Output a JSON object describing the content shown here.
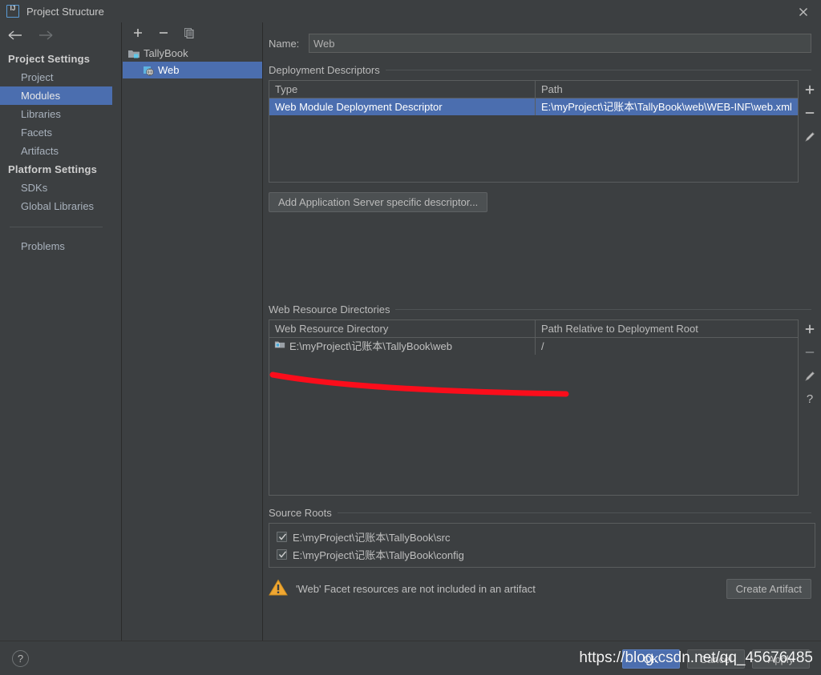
{
  "window": {
    "title": "Project Structure",
    "app_icon": "intellij-idea-icon",
    "close_icon": "close-icon"
  },
  "sidebar": {
    "back_icon": "arrow-left-icon",
    "forward_icon": "arrow-right-icon",
    "groups": [
      {
        "label": "Project Settings",
        "items": [
          {
            "label": "Project",
            "selected": false
          },
          {
            "label": "Modules",
            "selected": true
          },
          {
            "label": "Libraries",
            "selected": false
          },
          {
            "label": "Facets",
            "selected": false
          },
          {
            "label": "Artifacts",
            "selected": false
          }
        ]
      },
      {
        "label": "Platform Settings",
        "items": [
          {
            "label": "SDKs",
            "selected": false
          },
          {
            "label": "Global Libraries",
            "selected": false
          }
        ]
      }
    ],
    "problems_label": "Problems"
  },
  "module_panel": {
    "toolbar": {
      "add_icon": "plus-icon",
      "remove_icon": "minus-icon",
      "copy_icon": "copy-icon"
    },
    "tree": [
      {
        "label": "TallyBook",
        "level": 0,
        "icon": "module-folder-icon",
        "selected": false
      },
      {
        "label": "Web",
        "level": 1,
        "icon": "web-facet-icon",
        "selected": true
      }
    ]
  },
  "main": {
    "name": {
      "label": "Name:",
      "value": "Web"
    },
    "deployment_descriptors": {
      "title": "Deployment Descriptors",
      "columns": [
        "Type",
        "Path"
      ],
      "rows": [
        {
          "type": "Web Module Deployment Descriptor",
          "path": "E:\\myProject\\记账本\\TallyBook\\web\\WEB-INF\\web.xml",
          "selected": true
        }
      ],
      "tools": [
        "plus-icon",
        "minus-icon",
        "pencil-icon"
      ],
      "add_server_descriptor_button": "Add Application Server specific descriptor..."
    },
    "web_resource_directories": {
      "title": "Web Resource Directories",
      "columns": [
        "Web Resource Directory",
        "Path Relative to Deployment Root"
      ],
      "rows": [
        {
          "directory": "E:\\myProject\\记账本\\TallyBook\\web",
          "relative_path": "/",
          "icon": "folder-web-icon"
        }
      ],
      "tools": [
        "plus-icon",
        "minus-icon",
        "pencil-icon",
        "question-icon"
      ]
    },
    "source_roots": {
      "title": "Source Roots",
      "items": [
        {
          "path": "E:\\myProject\\记账本\\TallyBook\\src",
          "checked": true
        },
        {
          "path": "E:\\myProject\\记账本\\TallyBook\\config",
          "checked": true
        }
      ]
    },
    "warning": {
      "icon": "warning-triangle-icon",
      "text": "'Web' Facet resources are not included in an artifact",
      "action_button": "Create Artifact"
    }
  },
  "footer": {
    "help_label": "?",
    "buttons": [
      {
        "label": "OK",
        "style": "primary"
      },
      {
        "label": "Cancel",
        "style": "normal"
      },
      {
        "label": "Apply",
        "style": "normal"
      }
    ]
  },
  "watermark": {
    "text": "https://blog.csdn.net/qq_45676485"
  },
  "colors": {
    "selection_blue": "#4b6eaf",
    "background": "#3c3f41",
    "warning_orange": "#f0a732",
    "annotation_red": "#fb0d1b"
  }
}
